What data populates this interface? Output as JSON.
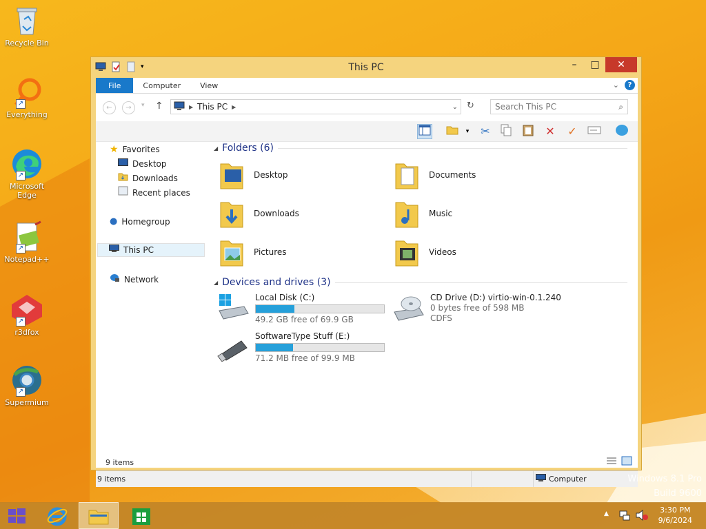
{
  "desktop": {
    "icons": [
      {
        "label": "Recycle Bin"
      },
      {
        "label": "Everything"
      },
      {
        "label": "Microsoft Edge"
      },
      {
        "label": "Notepad++"
      },
      {
        "label": "r3dfox"
      },
      {
        "label": "Supermium"
      }
    ],
    "watermark_line1": "Windows 8.1 Pro",
    "watermark_line2": "Build 9600"
  },
  "window": {
    "title": "This PC",
    "ribbon_tabs": [
      "File",
      "Computer",
      "View"
    ],
    "address_path": "This PC",
    "search_placeholder": "Search This PC",
    "nav": {
      "favorites": "Favorites",
      "favorites_items": [
        "Desktop",
        "Downloads",
        "Recent places"
      ],
      "homegroup": "Homegroup",
      "this_pc": "This PC",
      "network": "Network"
    },
    "folders_header": "Folders (6)",
    "folders": [
      "Desktop",
      "Documents",
      "Downloads",
      "Music",
      "Pictures",
      "Videos"
    ],
    "drives_header": "Devices and drives (3)",
    "drives": [
      {
        "name": "Local Disk (C:)",
        "free": "49.2 GB free of 69.9 GB",
        "used_fraction": 0.3
      },
      {
        "name": "CD Drive (D:) virtio-win-0.1.240",
        "free": "0 bytes free of 598 MB",
        "fs": "CDFS"
      },
      {
        "name": "SoftwareType Stuff (E:)",
        "free": "71.2 MB free of 99.9 MB",
        "used_fraction": 0.29
      }
    ],
    "items_count": "9 items",
    "status_items": "9 items",
    "status_location": "Computer"
  },
  "taskbar": {
    "time": "3:30 PM",
    "date": "9/6/2024"
  },
  "colors": {
    "accent": "#1979ca",
    "progress": "#26a0da",
    "window_frame": "#f5d47e",
    "close": "#c7392a"
  }
}
